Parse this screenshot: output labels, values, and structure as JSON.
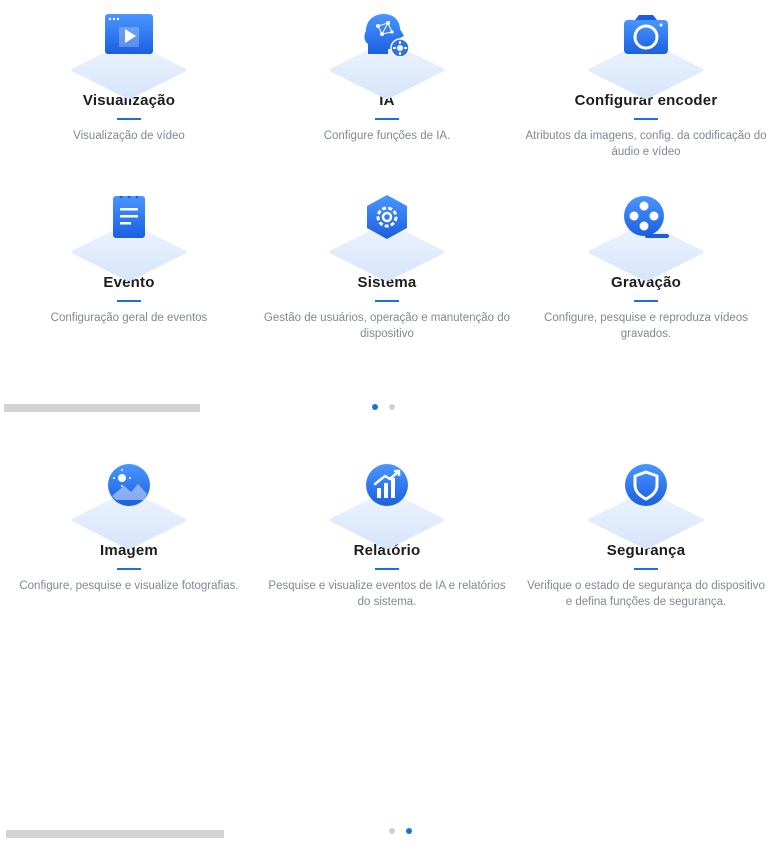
{
  "page1": {
    "tiles": [
      {
        "title": "Visualização",
        "desc": "Visualização de vídeo",
        "icon": "live-view-icon"
      },
      {
        "title": "IA",
        "desc": "Configure funções de IA.",
        "icon": "ai-head-icon"
      },
      {
        "title": "Configurar encoder",
        "desc": "Atributos da imagens, config. da codificação do áudio e vídeo",
        "icon": "camera-icon"
      },
      {
        "title": "Evento",
        "desc": "Configuração geral de eventos",
        "icon": "event-document-icon"
      },
      {
        "title": "Sistema",
        "desc": "Gestão de usuários, operação e manutenção do dispositivo",
        "icon": "system-gear-icon"
      },
      {
        "title": "Gravação",
        "desc": "Configure, pesquise e reproduza vídeos gravados.",
        "icon": "film-reel-icon"
      }
    ]
  },
  "page2": {
    "tiles": [
      {
        "title": "Imagem",
        "desc": "Configure, pesquise e visualize fotografias.",
        "icon": "image-icon"
      },
      {
        "title": "Relatório",
        "desc": "Pesquise e visualize eventos de IA e relatórios do sistema.",
        "icon": "report-chart-icon"
      },
      {
        "title": "Segurança",
        "desc": "Verifique o estado de segurança do dispositivo e defina funções de segurança.",
        "icon": "shield-icon"
      }
    ]
  },
  "pagination": {
    "pages": 2,
    "active_page_section1": 1,
    "active_page_section2": 2
  },
  "colors": {
    "accent": "#1d6fe0",
    "icon_gradient_top": "#4a96ff",
    "icon_gradient_bottom": "#1b5fe0",
    "desc_text": "#808894",
    "dot_inactive": "#c8d2de"
  }
}
